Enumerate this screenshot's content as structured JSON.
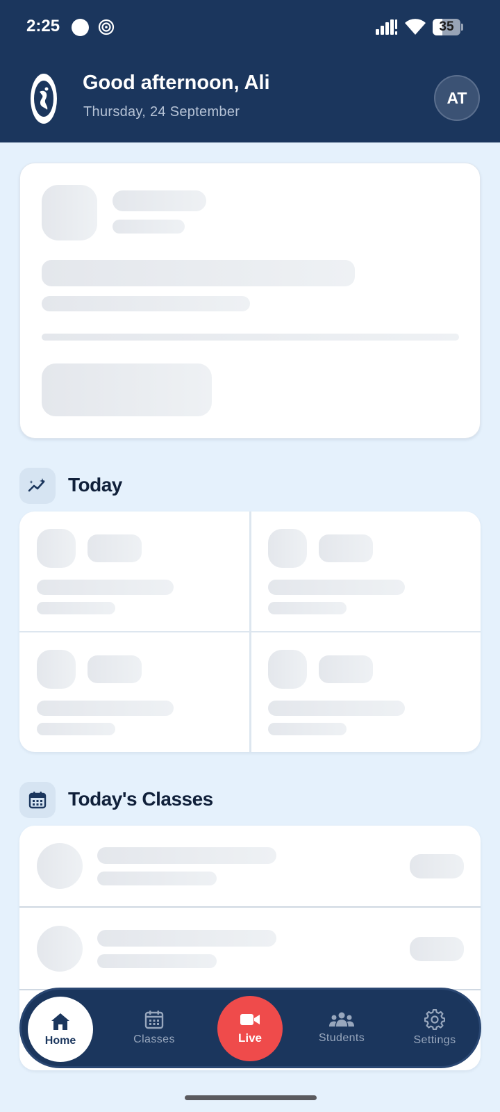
{
  "status_bar": {
    "time": "2:25",
    "battery_level": 35,
    "battery_label": "35"
  },
  "header": {
    "greeting": "Good afternoon, Ali",
    "date": "Thursday, 24 September",
    "avatar_initials": "AT"
  },
  "sections": {
    "today_title": "Today",
    "classes_title": "Today's Classes"
  },
  "bottom_nav": {
    "items": [
      {
        "label": "Home",
        "icon": "home-icon",
        "active": true
      },
      {
        "label": "Classes",
        "icon": "calendar-icon"
      },
      {
        "label": "Live",
        "icon": "video-icon"
      },
      {
        "label": "Students",
        "icon": "people-icon"
      },
      {
        "label": "Settings",
        "icon": "gear-icon"
      }
    ]
  },
  "colors": {
    "header_bg": "#1b365d",
    "page_bg": "#e5f1fc",
    "live_accent": "#ef4b4b"
  }
}
